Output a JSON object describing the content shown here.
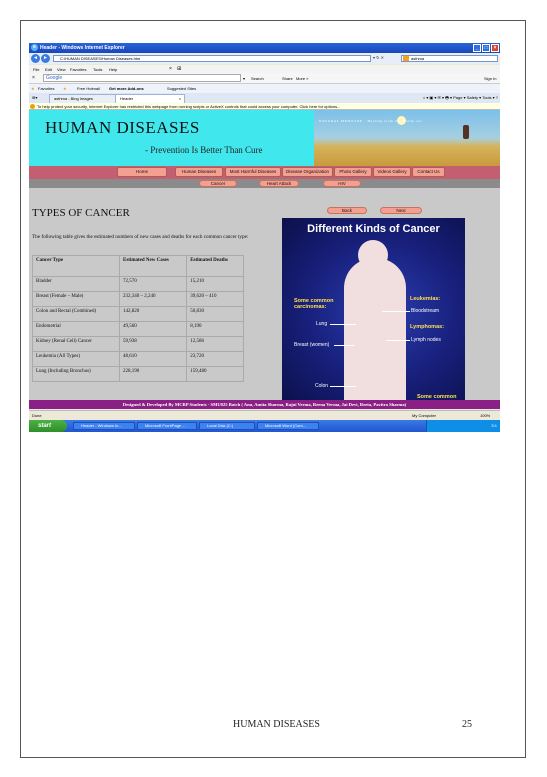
{
  "browser": {
    "window_title": "Header - Windows Internet Explorer",
    "address": "C:\\HUMAN DISEASES\\Human Diseases.htm",
    "live_search": "asthma",
    "menu": [
      "File",
      "Edit",
      "View",
      "Favorites",
      "Tools",
      "Help"
    ],
    "google_label": "Google",
    "google_items": [
      "Search",
      "Share",
      "More »",
      "Sign In"
    ],
    "favorites_label": "Favorites",
    "favorites_items": [
      "Free Hotmail",
      "Get more Add-ons",
      "Suggested Sites"
    ],
    "tabs": [
      "asthma - Bing Images",
      "Header"
    ],
    "tools_items": "Page ▾   Safety ▾   Tools ▾",
    "info_bar": "To help protect your security, Internet Explorer has restricted this webpage from running scripts or ActiveX controls that could access your computer. Click here for options...",
    "status_left": "Done",
    "status_zone": "My Computer",
    "status_zoom": "100%"
  },
  "site": {
    "title": "HUMAN DISEASES",
    "subtitle": "- Prevention Is Better Than Cure",
    "banner_text": "NATURAL MEDICINE · Healing from the inside out",
    "nav": [
      "Home",
      "Human Diseases",
      "Most Harmful Diseases",
      "Disease Organization",
      "Photo Gallery",
      "Videos Gallery",
      "Contact Us"
    ],
    "subnav": [
      "Cancer",
      "Heart Attack",
      "HIV"
    ],
    "page_heading": "TYPES OF CANCER",
    "back_label": "Back",
    "next_label": "Next",
    "intro": "The following table gives the estimated numbers of new cases and deaths for each common cancer type:",
    "table": {
      "headers": [
        "Cancer Type",
        "Estimated New Cases",
        "Estimated Deaths"
      ],
      "rows": [
        [
          "Bladder",
          "72,570",
          "15,210"
        ],
        [
          "Breast (Female – Male)",
          "232,340 – 2,240",
          "39,620 – 410"
        ],
        [
          "Colon and Rectal (Combined)",
          "142,820",
          "50,830"
        ],
        [
          "Endometrial",
          "49,560",
          "8,190"
        ],
        [
          "Kidney (Renal Cell) Cancer",
          "59,938",
          "12,586"
        ],
        [
          "Leukemia (All Types)",
          "48,610",
          "23,720"
        ],
        [
          "Lung (Including Bronchus)",
          "228,190",
          "159,480"
        ]
      ]
    },
    "diagram": {
      "title": "Different Kinds of Cancer",
      "left_heading": "Some common carcinomas:",
      "left_items": [
        "Lung",
        "Breast (women)",
        "Colon"
      ],
      "right_heading1": "Leukemias:",
      "right_item1": "Bloodstream",
      "right_heading2": "Lymphomas:",
      "right_item2": "Lymph nodes",
      "bottom_right": "Some common"
    },
    "footer": "Designed & Developed By MCRP Students - SMU025 Batch ( Anu, Amita Sharma, Rajni Verma, Reena Verma, Jai Devi, Reeta, Pavitra Sharma)"
  },
  "taskbar": {
    "start": "start",
    "tasks": [
      "Header - Windows In...",
      "Microsoft FrontPage ...",
      "Local Disk (C:)",
      "Microsoft Word (Com..."
    ],
    "clock": "5:1"
  },
  "page": {
    "footer_title": "HUMAN DISEASES",
    "page_number": "25"
  }
}
